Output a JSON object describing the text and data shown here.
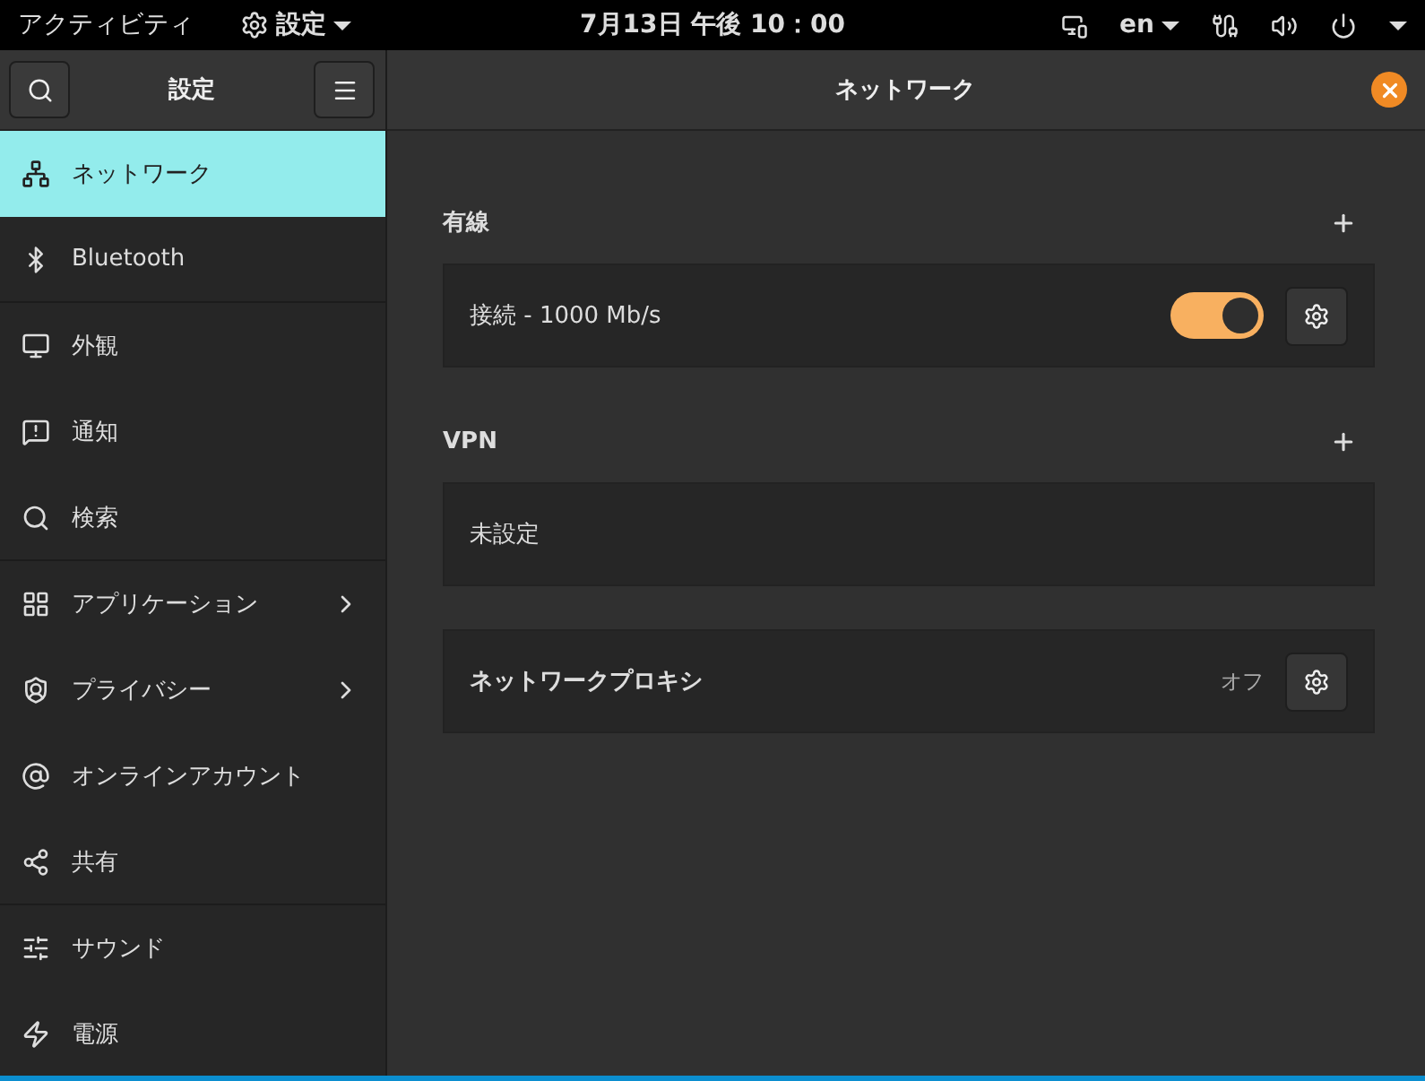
{
  "top_bar": {
    "activities": "アクティビティ",
    "app_menu": "設定",
    "clock": "7月13日 午後 10：00",
    "input_source": "en"
  },
  "sidebar": {
    "title": "設定",
    "items": [
      {
        "label": "ネットワーク",
        "selected": true,
        "has_submenu": false
      },
      {
        "label": "Bluetooth",
        "selected": false,
        "has_submenu": false
      },
      {
        "label": "外観",
        "selected": false,
        "has_submenu": false
      },
      {
        "label": "通知",
        "selected": false,
        "has_submenu": false
      },
      {
        "label": "検索",
        "selected": false,
        "has_submenu": false
      },
      {
        "label": "アプリケーション",
        "selected": false,
        "has_submenu": true
      },
      {
        "label": "プライバシー",
        "selected": false,
        "has_submenu": true
      },
      {
        "label": "オンラインアカウント",
        "selected": false,
        "has_submenu": false
      },
      {
        "label": "共有",
        "selected": false,
        "has_submenu": false
      },
      {
        "label": "サウンド",
        "selected": false,
        "has_submenu": false
      },
      {
        "label": "電源",
        "selected": false,
        "has_submenu": false
      }
    ]
  },
  "window": {
    "title": "ネットワーク"
  },
  "sections": [
    {
      "heading": "有線",
      "rows": [
        {
          "kind": "toggle",
          "label": "接続 - 1000 Mb/s",
          "on": true
        }
      ]
    },
    {
      "heading": "VPN",
      "rows": [
        {
          "kind": "plain",
          "label": "未設定"
        }
      ]
    },
    {
      "rows": [
        {
          "kind": "status",
          "label": "ネットワークプロキシ",
          "status": "オフ"
        }
      ]
    }
  ]
}
